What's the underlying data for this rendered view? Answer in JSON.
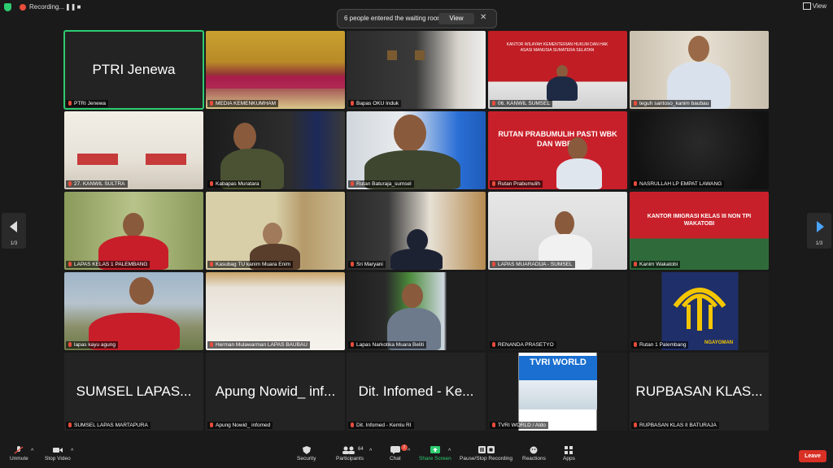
{
  "topbar": {
    "recording_label": "Recording...",
    "view_label": "View"
  },
  "notice": {
    "text": "6 people entered the waiting room",
    "view_button": "View"
  },
  "pager": {
    "left_count": "1/3",
    "right_count": "1/3"
  },
  "tiles": [
    {
      "big": "PTRI Jenewa",
      "label": "PTRI Jenewa"
    },
    {
      "label": "MEDIA KEMENKUMHAM"
    },
    {
      "label": "Bapas OKU Induk"
    },
    {
      "label": "06. KANWIL SUMSEL",
      "poster": "KANTOR WILAYAH KEMENTERIAN HUKUM DAN HAK ASASI MANUSIA SUMATERA SELATAN"
    },
    {
      "label": "teguh santoso_kanim baubau"
    },
    {
      "label": "27. KANWIL SULTRA"
    },
    {
      "label": "Kabapas Muratara"
    },
    {
      "label": "Rutan Baturaja_sumsel"
    },
    {
      "label": "Rutan Prabumulih",
      "poster": "RUTAN PRABUMULIH PASTI WBK DAN WBBM"
    },
    {
      "label": "NASRULLAH LP EMPAT LAWANG"
    },
    {
      "label": "LAPAS KELAS 1 PALEMBANG"
    },
    {
      "label": "Kasubag TU kanim Muara Enim"
    },
    {
      "label": "Sri Maryani"
    },
    {
      "label": "LAPAS MUARADUA - SUMSEL"
    },
    {
      "label": "Kanim Wakatobi",
      "poster": "KANTOR IMIGRASI KELAS III NON TPI WAKATOBI"
    },
    {
      "label": "lapas kayu agung"
    },
    {
      "label": "Herman Mulawarman LAPAS BAUBAU"
    },
    {
      "label": "Lapas Narkotika Muara Beliti"
    },
    {
      "label": "RENANDA PRASETYO"
    },
    {
      "label": "Rutan 1 Palembang",
      "poster": "NGAYOMAN"
    },
    {
      "big": "SUMSEL LAPAS...",
      "label": "SUMSEL LAPAS MARTAPURA"
    },
    {
      "big": "Apung Nowid_ inf...",
      "label": "Apung Nowid_ infomed"
    },
    {
      "big": "Dit. Infomed - Ke...",
      "label": "Dit. Infomed - Kemlu RI"
    },
    {
      "label": "TVRI WORLD / Aldo",
      "poster": "TVRI WORLD"
    },
    {
      "big": "RUPBASAN KLAS...",
      "label": "RUPBASAN KLAS II BATURAJA"
    }
  ],
  "toolbar": {
    "unmute": "Unmute",
    "stop_video": "Stop Video",
    "security": "Security",
    "participants": "Participants",
    "participants_count": "64",
    "chat": "Chat",
    "chat_badge": "2",
    "share_screen": "Share Screen",
    "pause_recording": "Pause/Stop Recording",
    "reactions": "Reactions",
    "apps": "Apps",
    "leave": "Leave"
  },
  "colors": {
    "active_border": "#2ecc71",
    "share_green": "#2ecc71",
    "leave_red": "#d93025",
    "pager_arrow": "#4aa3ff"
  }
}
